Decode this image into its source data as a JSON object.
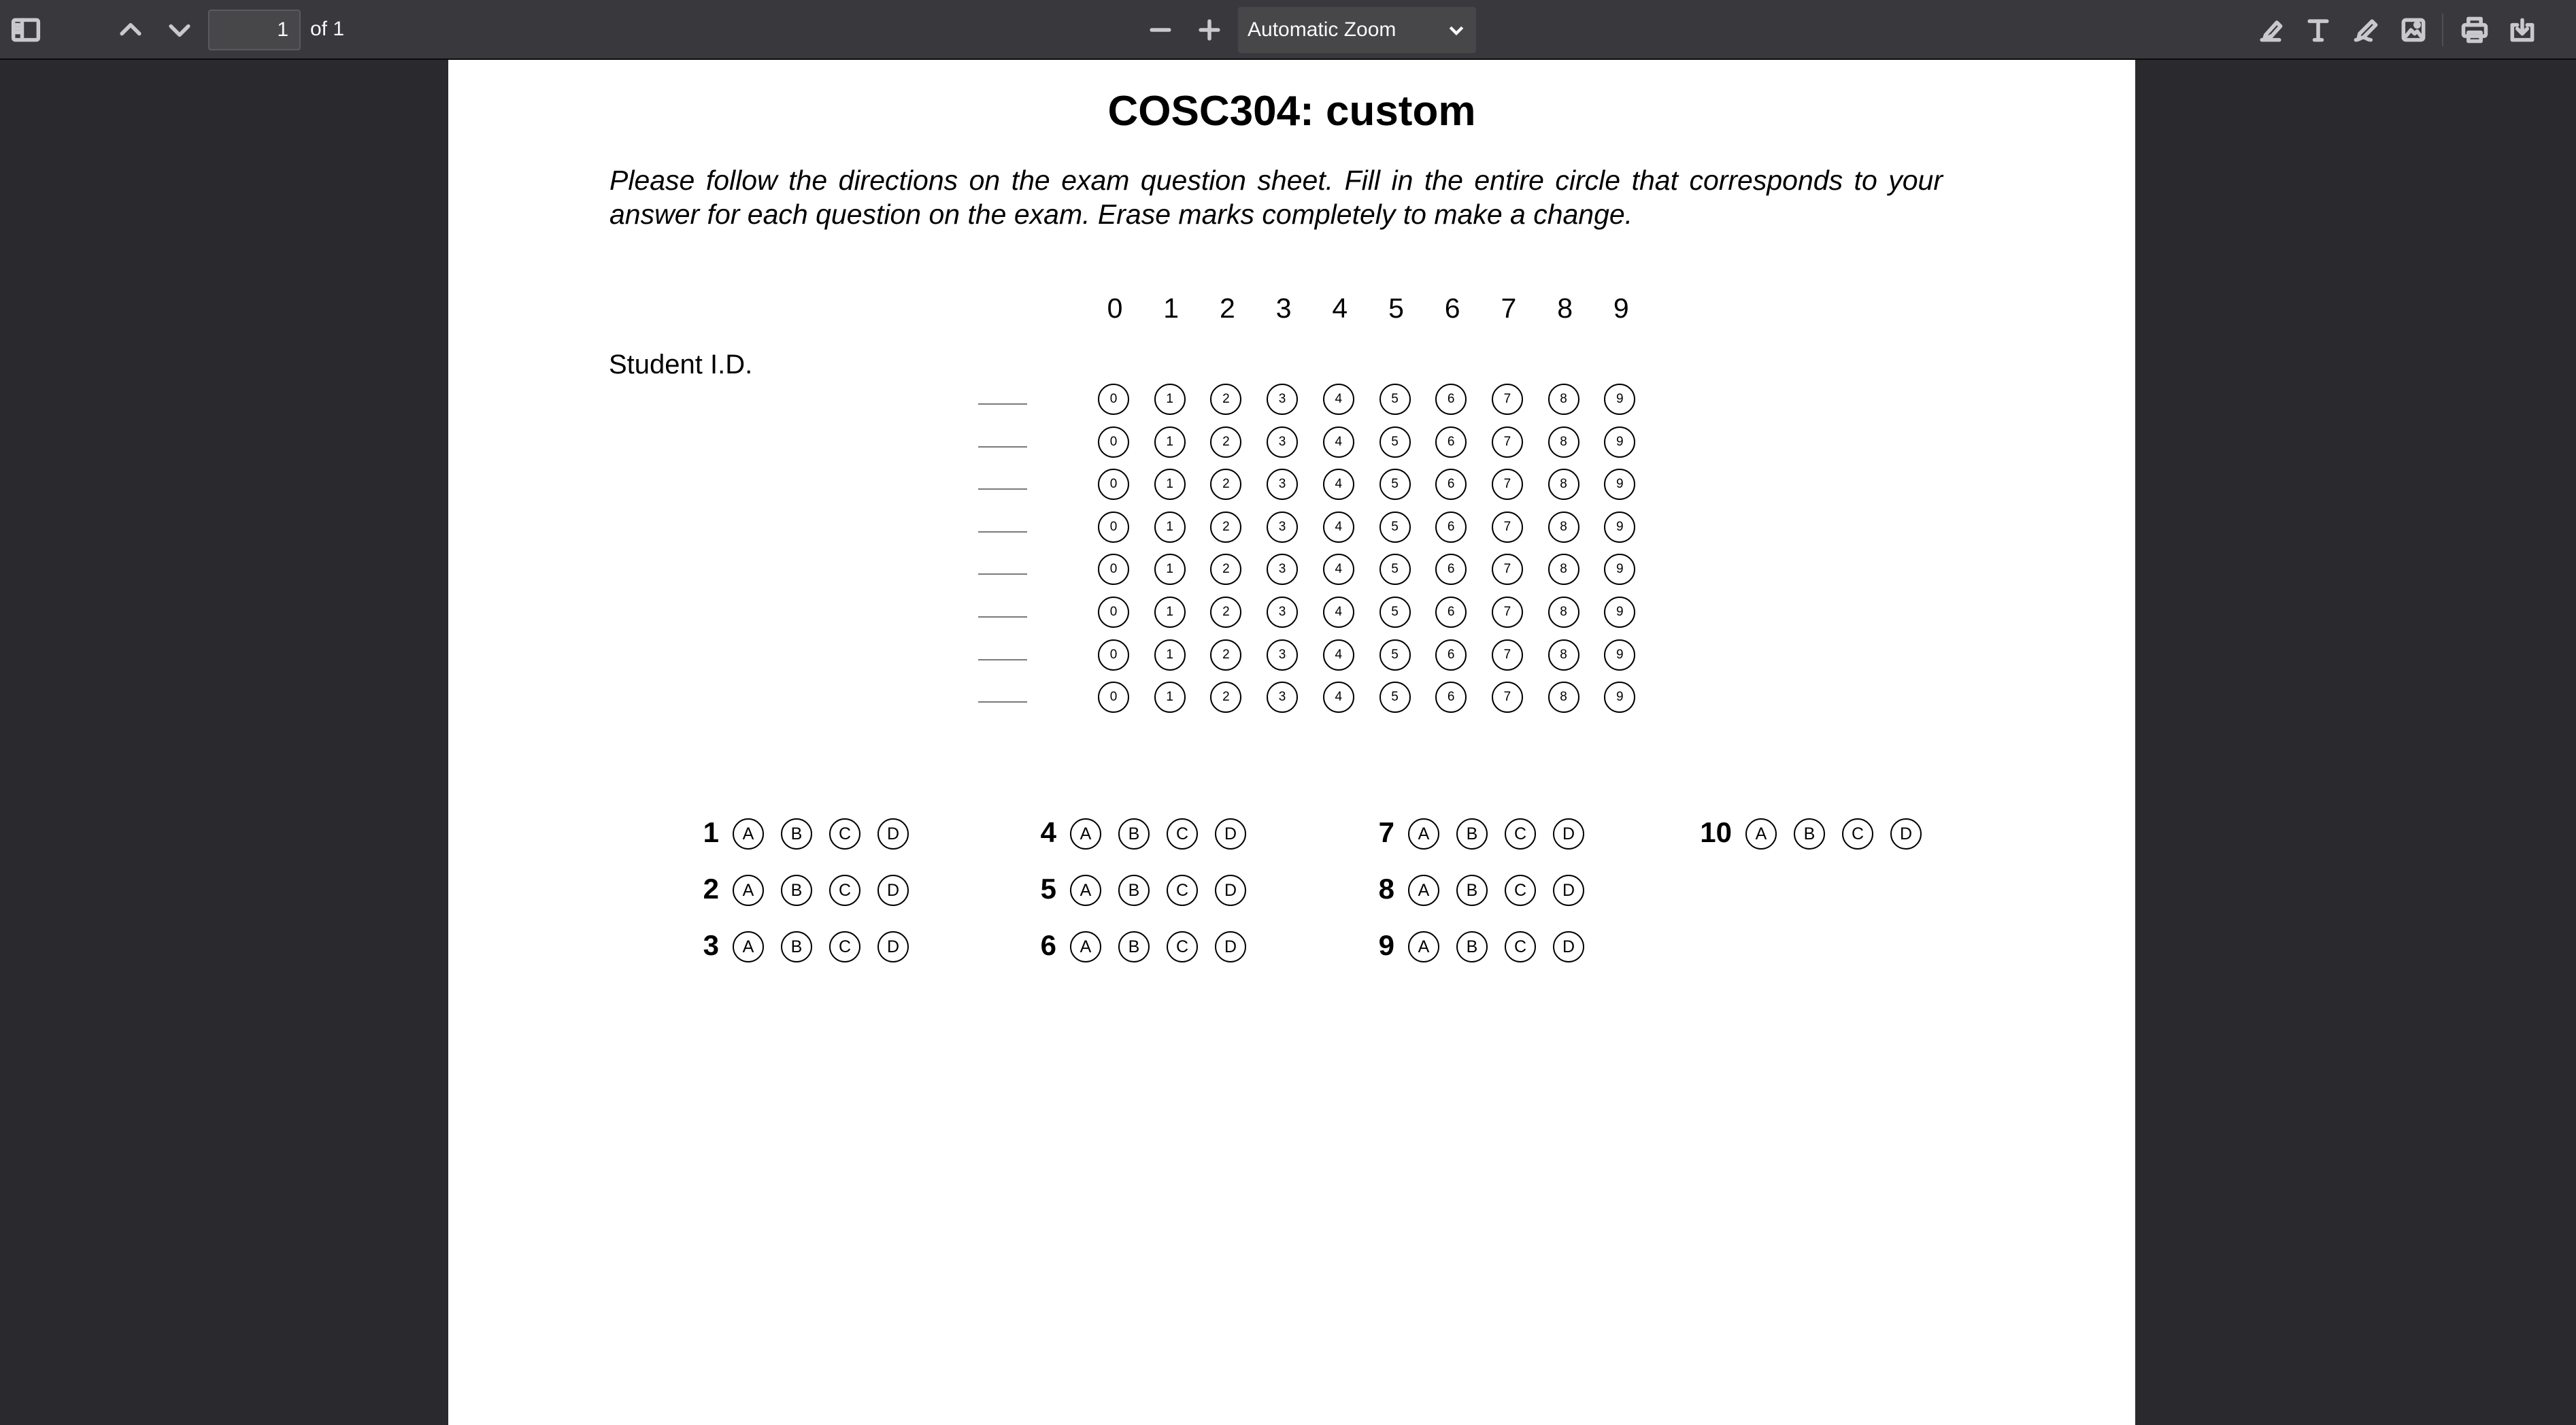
{
  "toolbar": {
    "page_number": "1",
    "page_count": "of 1",
    "zoom_label": "Automatic Zoom"
  },
  "document": {
    "title": "COSC304: custom",
    "instructions": "Please follow the directions on the exam question sheet.  Fill in the entire circle that corresponds to your answer for each question on the exam. Erase marks completely to make a change.",
    "id_label": "Student I.D.",
    "id_digit_headers": [
      "0",
      "1",
      "2",
      "3",
      "4",
      "5",
      "6",
      "7",
      "8",
      "9"
    ],
    "id_rows": 8,
    "id_bubble_labels": [
      "0",
      "1",
      "2",
      "3",
      "4",
      "5",
      "6",
      "7",
      "8",
      "9"
    ],
    "answer_choices": [
      "A",
      "B",
      "C",
      "D"
    ],
    "questions": [
      "1",
      "2",
      "3",
      "4",
      "5",
      "6",
      "7",
      "8",
      "9",
      "10"
    ]
  }
}
